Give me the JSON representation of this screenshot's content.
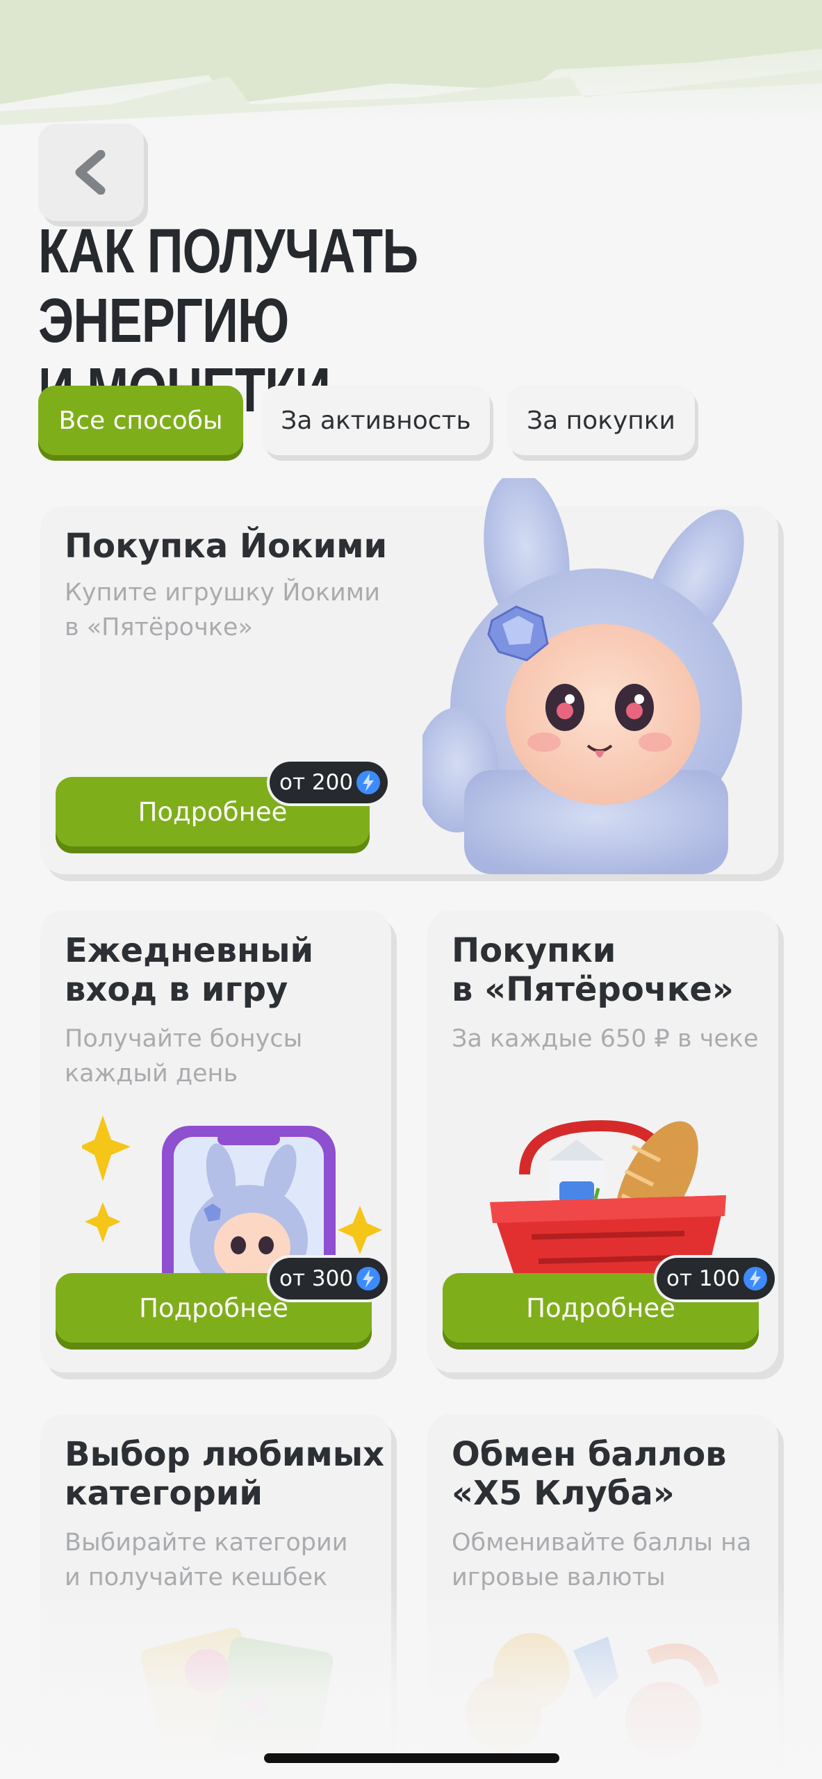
{
  "header": {
    "back_icon": "chevron-left-icon",
    "title_line1": "КАК ПОЛУЧАТЬ ЭНЕРГИЮ",
    "title_line2": "И МОНЕТКИ"
  },
  "tabs": [
    {
      "label": "Все способы",
      "active": true
    },
    {
      "label": "За активность",
      "active": false
    },
    {
      "label": "За покупки",
      "active": false
    }
  ],
  "cards": [
    {
      "title": "Покупка Йокими",
      "subtitle_line1": "Купите игрушку Йокими",
      "subtitle_line2": "в «Пятёрочке»",
      "button": "Подробнее",
      "badge": "от 200",
      "illustration": "bunny-toy-icon"
    },
    {
      "title_line1": "Ежедневный",
      "title_line2": "вход в игру",
      "subtitle_line1": "Получайте бонусы",
      "subtitle_line2": "каждый день",
      "button": "Подробнее",
      "badge": "от 300",
      "illustration": "phone-with-bunny-icon"
    },
    {
      "title_line1": "Покупки",
      "title_line2": "в «Пятёрочке»",
      "subtitle_line1": "За каждые 650 ₽ в чеке",
      "button": "Подробнее",
      "badge": "от 100",
      "illustration": "grocery-basket-icon"
    },
    {
      "title_line1": "Выбор любимых",
      "title_line2": "категорий",
      "subtitle_line1": "Выбирайте категории",
      "subtitle_line2": "и получайте кешбек",
      "illustration": "candy-cards-icon"
    },
    {
      "title_line1": "Обмен баллов",
      "title_line2": "«X5 Клуба»",
      "subtitle_line1": "Обменивайте баллы на",
      "subtitle_line2": "игровые валюты",
      "illustration": "coins-exchange-icon"
    }
  ],
  "colors": {
    "accent": "#7fae1b",
    "accent_dark": "#5f8a0d",
    "badge_bg": "#26292d",
    "energy_blue": "#3d8bff",
    "background": "#f6f6f6"
  }
}
